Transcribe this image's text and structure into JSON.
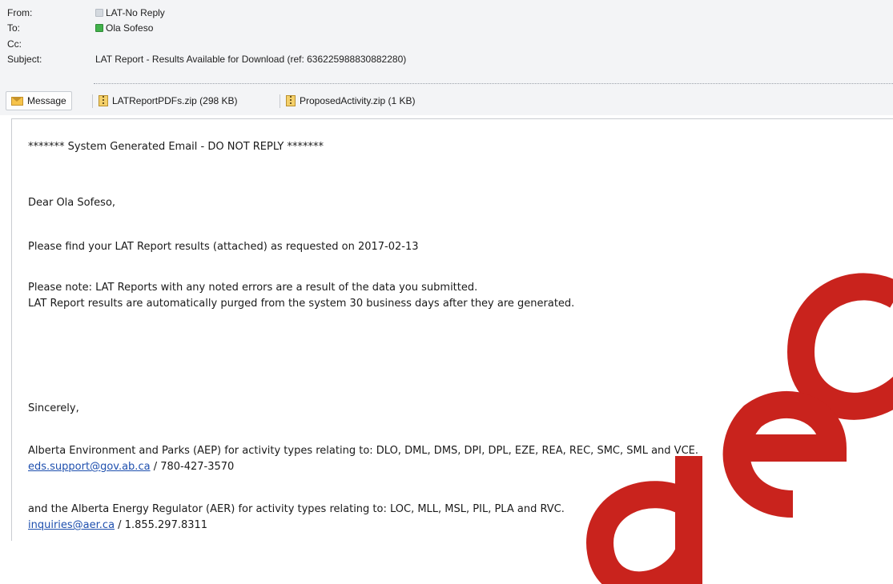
{
  "header": {
    "from_label": "From:",
    "from_value": "LAT-No Reply",
    "to_label": "To:",
    "to_value": "Ola Sofeso",
    "cc_label": "Cc:",
    "cc_value": "",
    "subject_label": "Subject:",
    "subject_value": "LAT Report - Results Available for Download  (ref: 636225988830882280)"
  },
  "tabs": {
    "message_label": "Message",
    "attachments": [
      {
        "label": "LATReportPDFs.zip (298 KB)"
      },
      {
        "label": "ProposedActivity.zip (1 KB)"
      }
    ]
  },
  "body": {
    "system_notice": "******* System Generated Email - DO NOT REPLY *******",
    "greeting": "Dear Ola Sofeso,",
    "line_find": "Please find your LAT Report results (attached) as requested on 2017-02-13",
    "line_note": "Please note: LAT Reports with any noted errors are a result of the data you submitted.",
    "line_purge": "LAT Report results are automatically purged from the system 30 business days after they are generated.",
    "sincerely": "Sincerely,",
    "aep_line": "Alberta Environment and Parks (AEP) for activity types relating to: DLO, DML, DMS, DPI, DPL, EZE, REA, REC, SMC, SML and VCE.",
    "aep_email": "eds.support@gov.ab.ca",
    "aep_phone": " / 780-427-3570",
    "aer_line": "and the Alberta Energy Regulator (AER) for activity types relating to: LOC, MLL, MSL, PIL, PLA and RVC.",
    "aer_email": "inquiries@aer.ca",
    "aer_phone": " / 1.855.297.8311"
  },
  "colors": {
    "link": "#1e4fae",
    "watermark": "#c9231d",
    "header_bg": "#f3f4f6"
  }
}
